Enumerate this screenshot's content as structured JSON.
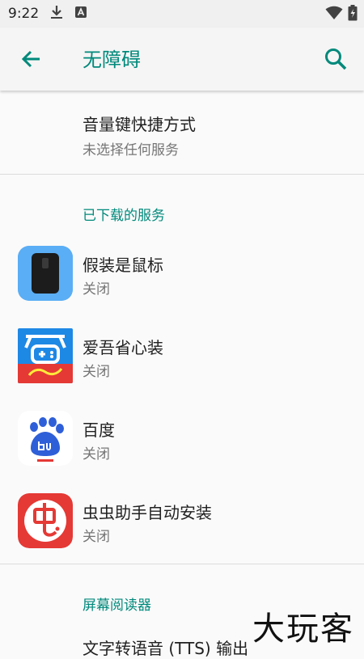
{
  "status": {
    "time": "9:22"
  },
  "header": {
    "title": "无障碍"
  },
  "volume_shortcut": {
    "title": "音量键快捷方式",
    "subtitle": "未选择任何服务"
  },
  "downloaded_section": {
    "header": "已下载的服务",
    "items": [
      {
        "name": "假装是鼠标",
        "state": "关闭",
        "icon": "mouse-app-icon"
      },
      {
        "name": "爱吾省心装",
        "state": "关闭",
        "icon": "aiwu-app-icon"
      },
      {
        "name": "百度",
        "state": "关闭",
        "icon": "baidu-app-icon"
      },
      {
        "name": "虫虫助手自动安装",
        "state": "关闭",
        "icon": "chongchong-app-icon"
      }
    ]
  },
  "screen_reader_section": {
    "header": "屏幕阅读器",
    "partial_item": "文字转语音 (TTS) 输出"
  },
  "watermark": "大玩客",
  "colors": {
    "accent": "#00897b",
    "primary_text": "#212121",
    "secondary_text": "#757575"
  }
}
